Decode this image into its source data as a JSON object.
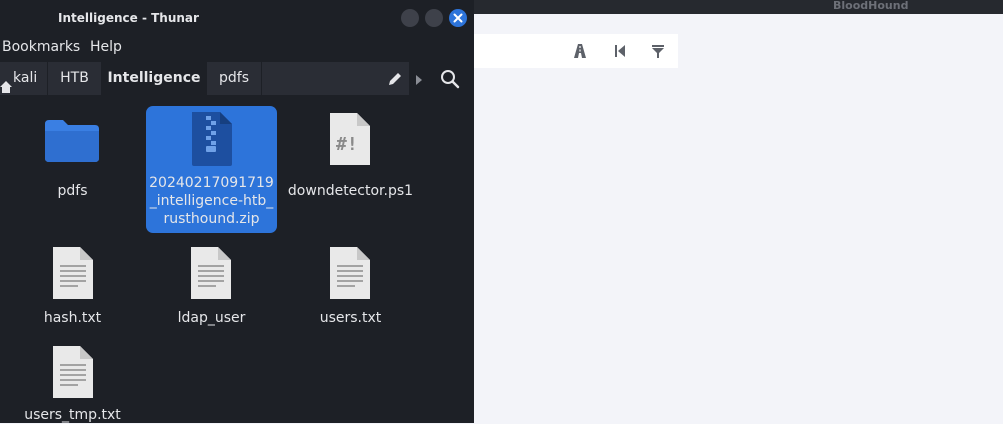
{
  "bloodhound": {
    "title": "BloodHound",
    "toolbar_icons": [
      "path-icon",
      "back-icon",
      "filter-icon"
    ]
  },
  "thunar": {
    "title": "Intelligence - Thunar",
    "menu": [
      "Bookmarks",
      "Help"
    ],
    "path": [
      "kali",
      "HTB",
      "Intelligence",
      "pdfs"
    ],
    "active_crumb": "Intelligence",
    "files": [
      {
        "name": "pdfs",
        "type": "folder",
        "selected": false
      },
      {
        "name": "20240217091719_intelligence-htb_rusthound.zip",
        "type": "zip",
        "selected": true
      },
      {
        "name": "downdetector.ps1",
        "type": "script",
        "selected": false
      },
      {
        "name": "hash.txt",
        "type": "text",
        "selected": false
      },
      {
        "name": "ldap_user",
        "type": "text",
        "selected": false
      },
      {
        "name": "users.txt",
        "type": "text",
        "selected": false
      },
      {
        "name": "users_tmp.txt",
        "type": "text",
        "selected": false
      }
    ]
  },
  "colors": {
    "accent": "#2d74da",
    "window_bg": "#1d2026",
    "crumb_bg": "#2a2d35",
    "text": "#e5e6e9",
    "bloodhound_bg": "#f3f4f9"
  }
}
